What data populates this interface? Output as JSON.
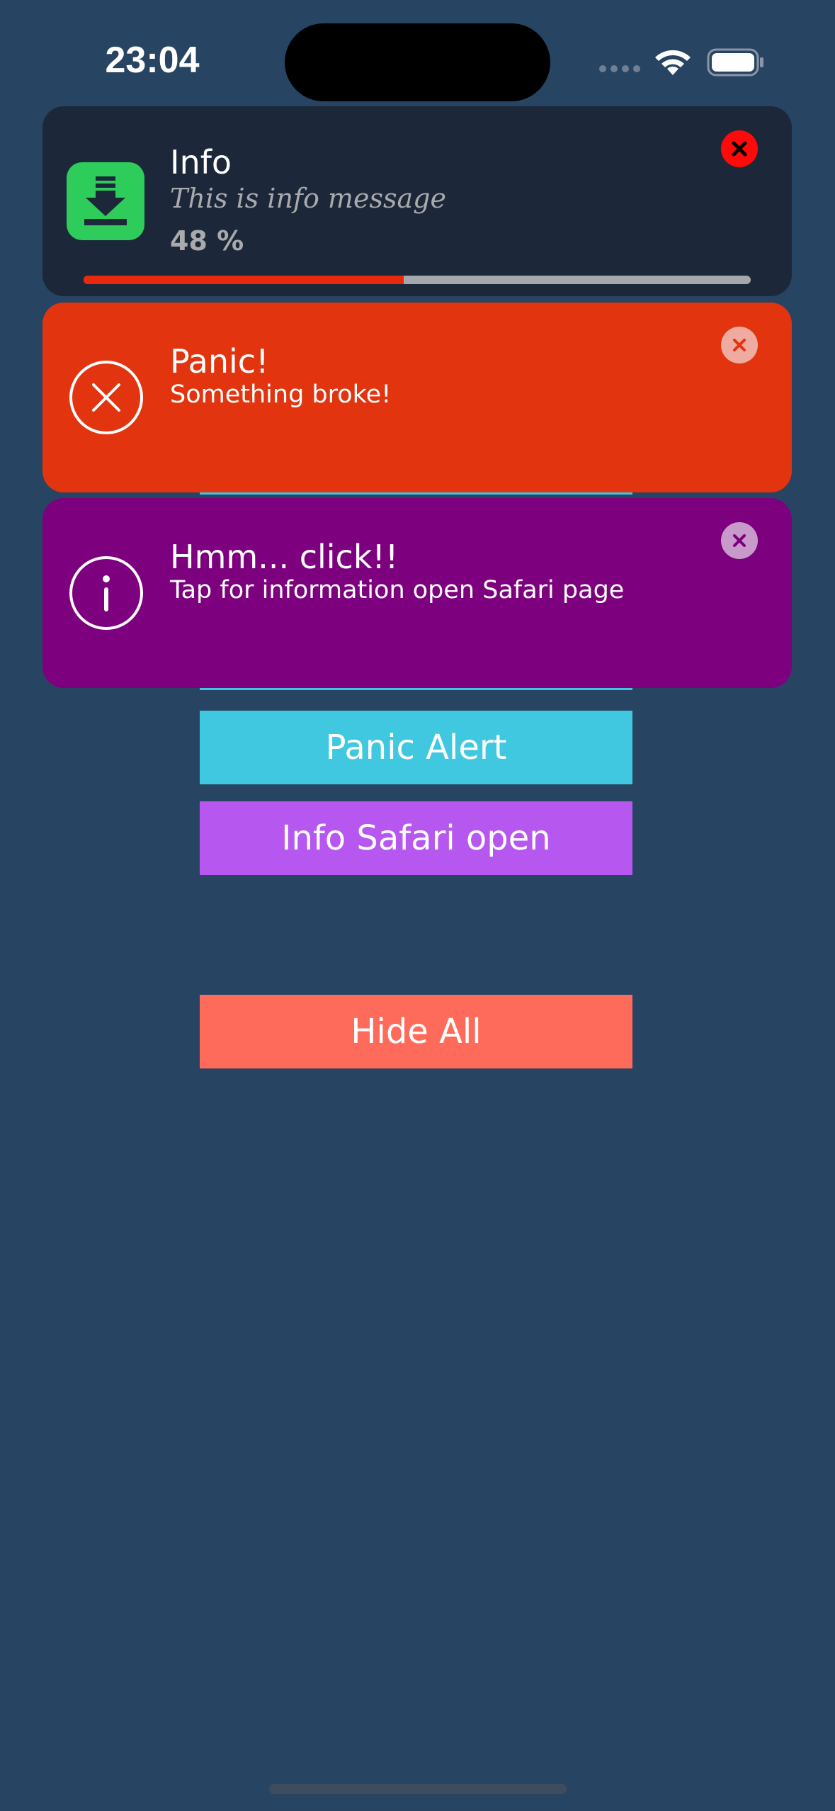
{
  "status_bar": {
    "time": "23:04",
    "icons": [
      "signal-icon",
      "wifi-icon",
      "battery-icon"
    ]
  },
  "buttons": {
    "panic_alert": "Panic Alert",
    "info_safari": "Info Safari open",
    "hide_all": "Hide All"
  },
  "notifications": {
    "info": {
      "title": "Info",
      "message": "This is info message",
      "progress_text": "48 %",
      "progress_fraction": 0.48,
      "icon": "download-icon"
    },
    "panic": {
      "title": "Panic!",
      "message": "Something broke!",
      "icon": "error-x-circle-icon"
    },
    "hmm": {
      "title": "Hmm... click!!",
      "message": "Tap for information open Safari page",
      "icon": "info-circle-icon"
    }
  },
  "colors": {
    "background": "#284463",
    "info_card": "#1c2739",
    "panic_card": "#e1340f",
    "hmm_card": "#7d007f",
    "download_green": "#2ecc5a",
    "progress_fill": "#e8290e",
    "progress_track": "#a4a7ab",
    "button_cyan": "#40c8e0",
    "button_purple": "#b657f0",
    "button_coral": "#ff6b5b"
  }
}
